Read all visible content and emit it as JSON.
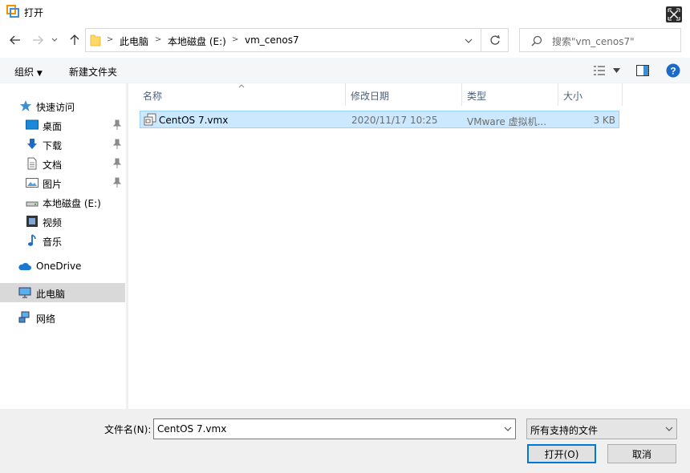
{
  "window": {
    "title": "打开"
  },
  "address": {
    "crumbs": [
      "此电脑",
      "本地磁盘 (E:)",
      "vm_cenos7"
    ]
  },
  "search": {
    "placeholder": "搜索\"vm_cenos7\""
  },
  "toolbar": {
    "organize_label": "组织",
    "new_folder_label": "新建文件夹"
  },
  "sidebar": {
    "items": [
      {
        "label": "快速访问",
        "icon": "star-icon"
      },
      {
        "label": "桌面",
        "icon": "desktop-icon",
        "pinned": true
      },
      {
        "label": "下载",
        "icon": "download-icon",
        "pinned": true
      },
      {
        "label": "文档",
        "icon": "document-icon",
        "pinned": true
      },
      {
        "label": "图片",
        "icon": "picture-icon",
        "pinned": true
      },
      {
        "label": "本地磁盘 (E:)",
        "icon": "drive-icon"
      },
      {
        "label": "视频",
        "icon": "video-icon"
      },
      {
        "label": "音乐",
        "icon": "music-icon"
      },
      {
        "label": "OneDrive",
        "icon": "cloud-icon"
      },
      {
        "label": "此电脑",
        "icon": "computer-icon",
        "selected": true
      },
      {
        "label": "网络",
        "icon": "network-icon"
      }
    ]
  },
  "columns": {
    "name": "名称",
    "date": "修改日期",
    "type": "类型",
    "size": "大小"
  },
  "files": [
    {
      "name": "CentOS 7.vmx",
      "date": "2020/11/17 10:25",
      "type": "VMware 虚拟机...",
      "size": "3 KB"
    }
  ],
  "bottom": {
    "filename_label": "文件名(N):",
    "filename_value": "CentOS 7.vmx",
    "filter_value": "所有支持的文件",
    "open_label": "打开(O)",
    "cancel_label": "取消"
  },
  "colors": {
    "accent": "#0078d7",
    "selection": "#cce8ff",
    "folder": "#ffd866"
  }
}
